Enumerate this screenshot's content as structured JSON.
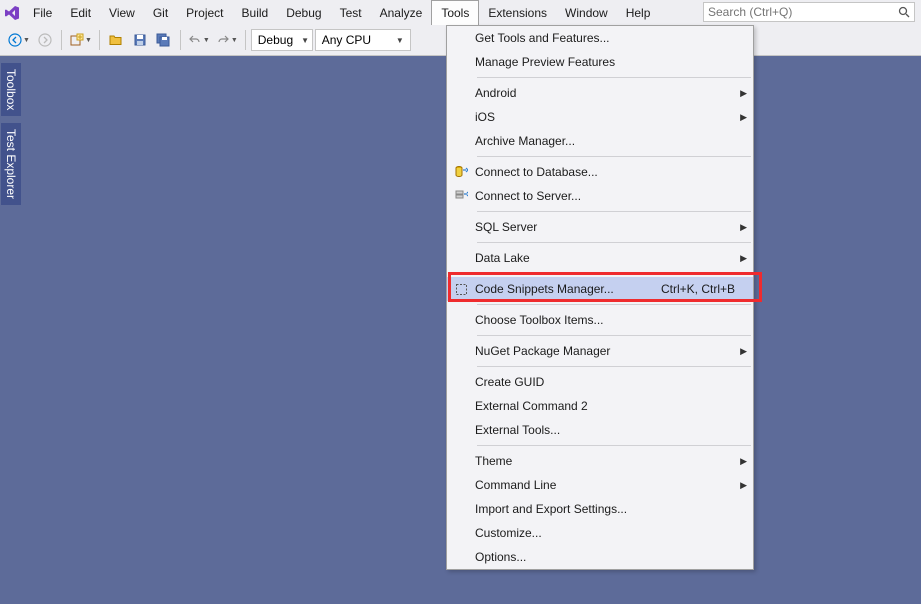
{
  "menubar": {
    "items": [
      "File",
      "Edit",
      "View",
      "Git",
      "Project",
      "Build",
      "Debug",
      "Test",
      "Analyze",
      "Tools",
      "Extensions",
      "Window",
      "Help"
    ],
    "open_index": 9
  },
  "search": {
    "placeholder": "Search (Ctrl+Q)"
  },
  "toolbar": {
    "config": "Debug",
    "platform": "Any CPU"
  },
  "side_tabs": [
    "Toolbox",
    "Test Explorer"
  ],
  "tools_menu": [
    {
      "type": "item",
      "label": "Get Tools and Features..."
    },
    {
      "type": "item",
      "label": "Manage Preview Features"
    },
    {
      "type": "sep"
    },
    {
      "type": "item",
      "label": "Android",
      "submenu": true
    },
    {
      "type": "item",
      "label": "iOS",
      "submenu": true
    },
    {
      "type": "item",
      "label": "Archive Manager..."
    },
    {
      "type": "sep"
    },
    {
      "type": "item",
      "label": "Connect to Database...",
      "icon": "db"
    },
    {
      "type": "item",
      "label": "Connect to Server...",
      "icon": "server"
    },
    {
      "type": "sep"
    },
    {
      "type": "item",
      "label": "SQL Server",
      "submenu": true
    },
    {
      "type": "sep"
    },
    {
      "type": "item",
      "label": "Data Lake",
      "submenu": true
    },
    {
      "type": "sep"
    },
    {
      "type": "item",
      "label": "Code Snippets Manager...",
      "shortcut": "Ctrl+K, Ctrl+B",
      "icon": "snippet",
      "highlighted": true
    },
    {
      "type": "sep"
    },
    {
      "type": "item",
      "label": "Choose Toolbox Items..."
    },
    {
      "type": "sep"
    },
    {
      "type": "item",
      "label": "NuGet Package Manager",
      "submenu": true
    },
    {
      "type": "sep"
    },
    {
      "type": "item",
      "label": "Create GUID"
    },
    {
      "type": "item",
      "label": "External Command 2"
    },
    {
      "type": "item",
      "label": "External Tools..."
    },
    {
      "type": "sep"
    },
    {
      "type": "item",
      "label": "Theme",
      "submenu": true
    },
    {
      "type": "item",
      "label": "Command Line",
      "submenu": true
    },
    {
      "type": "item",
      "label": "Import and Export Settings..."
    },
    {
      "type": "item",
      "label": "Customize..."
    },
    {
      "type": "item",
      "label": "Options..."
    }
  ]
}
